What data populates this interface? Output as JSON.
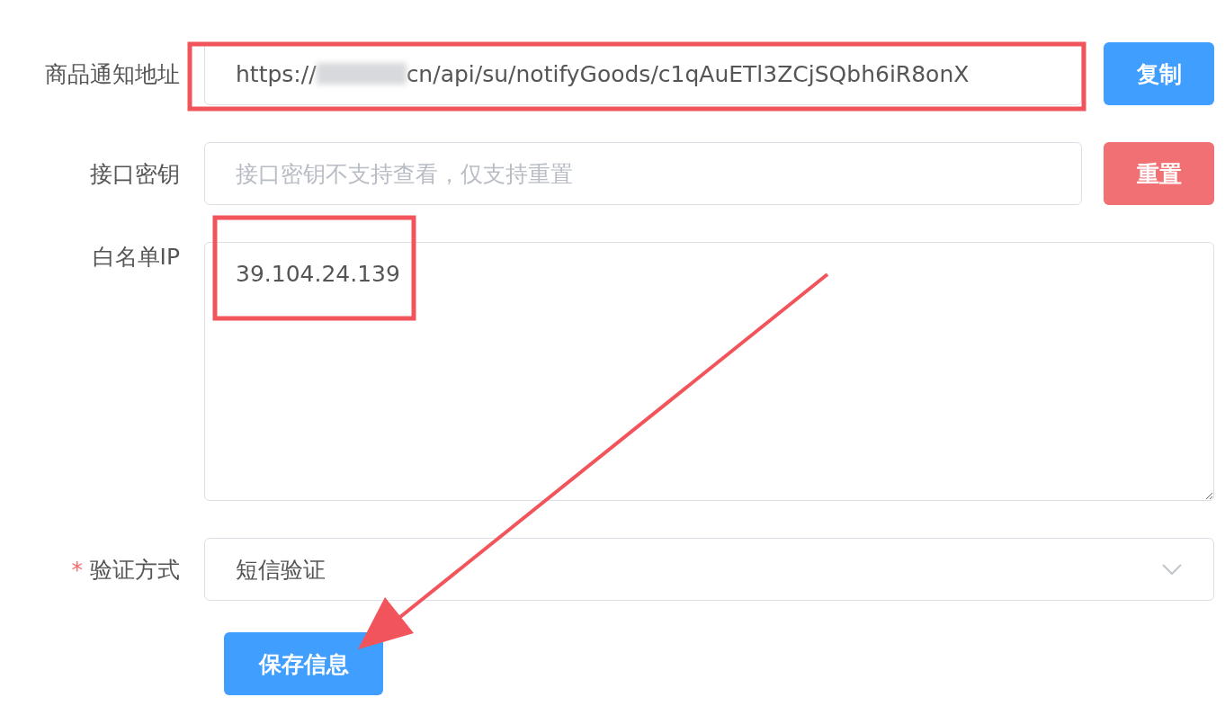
{
  "form": {
    "rows": [
      {
        "kind": "url",
        "label": "商品通知地址",
        "value_prefix": "https://",
        "value_rest": "cn/api/su/notifyGoods/c1qAuETl3ZCjSQbh6iR8onX",
        "button": {
          "label": "复制",
          "kind": "primary"
        }
      },
      {
        "kind": "secret",
        "label": "接口密钥",
        "placeholder": "接口密钥不支持查看，仅支持重置",
        "button": {
          "label": "重置",
          "kind": "danger"
        }
      },
      {
        "kind": "textarea",
        "label": "白名单IP",
        "value": "39.104.24.139"
      },
      {
        "kind": "select",
        "label": "验证方式",
        "required_mark": "*",
        "value": "短信验证"
      }
    ],
    "submit": {
      "label": "保存信息"
    }
  }
}
